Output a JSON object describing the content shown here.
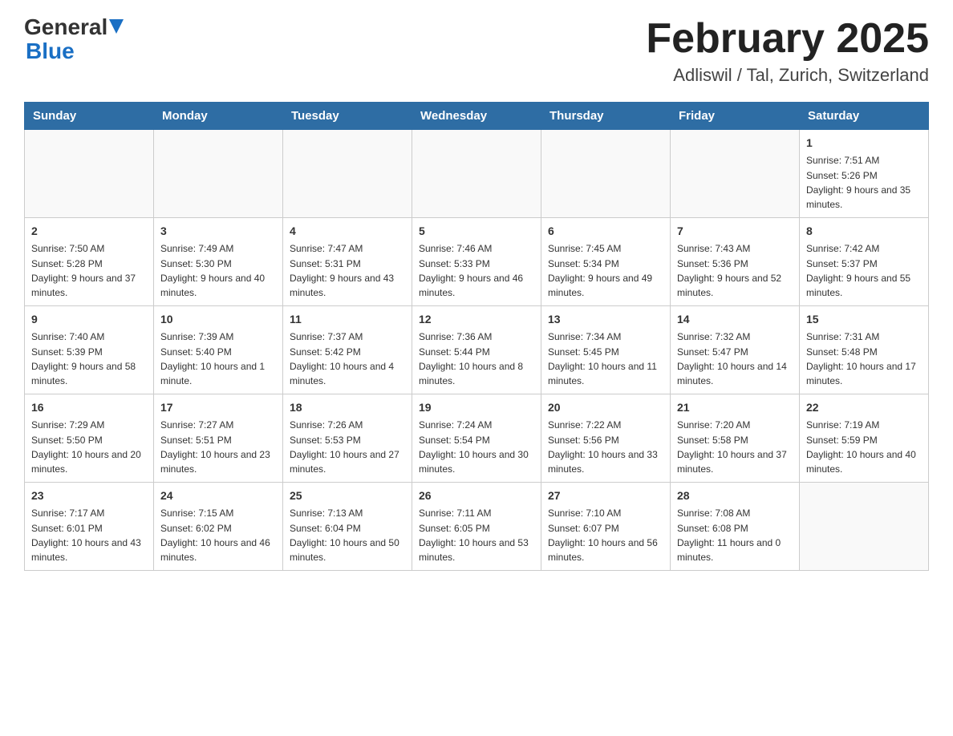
{
  "header": {
    "logo_general": "General",
    "logo_blue": "Blue",
    "month_title": "February 2025",
    "subtitle": "Adliswil / Tal, Zurich, Switzerland"
  },
  "days_of_week": [
    "Sunday",
    "Monday",
    "Tuesday",
    "Wednesday",
    "Thursday",
    "Friday",
    "Saturday"
  ],
  "weeks": [
    [
      {
        "day": "",
        "info": ""
      },
      {
        "day": "",
        "info": ""
      },
      {
        "day": "",
        "info": ""
      },
      {
        "day": "",
        "info": ""
      },
      {
        "day": "",
        "info": ""
      },
      {
        "day": "",
        "info": ""
      },
      {
        "day": "1",
        "info": "Sunrise: 7:51 AM\nSunset: 5:26 PM\nDaylight: 9 hours and 35 minutes."
      }
    ],
    [
      {
        "day": "2",
        "info": "Sunrise: 7:50 AM\nSunset: 5:28 PM\nDaylight: 9 hours and 37 minutes."
      },
      {
        "day": "3",
        "info": "Sunrise: 7:49 AM\nSunset: 5:30 PM\nDaylight: 9 hours and 40 minutes."
      },
      {
        "day": "4",
        "info": "Sunrise: 7:47 AM\nSunset: 5:31 PM\nDaylight: 9 hours and 43 minutes."
      },
      {
        "day": "5",
        "info": "Sunrise: 7:46 AM\nSunset: 5:33 PM\nDaylight: 9 hours and 46 minutes."
      },
      {
        "day": "6",
        "info": "Sunrise: 7:45 AM\nSunset: 5:34 PM\nDaylight: 9 hours and 49 minutes."
      },
      {
        "day": "7",
        "info": "Sunrise: 7:43 AM\nSunset: 5:36 PM\nDaylight: 9 hours and 52 minutes."
      },
      {
        "day": "8",
        "info": "Sunrise: 7:42 AM\nSunset: 5:37 PM\nDaylight: 9 hours and 55 minutes."
      }
    ],
    [
      {
        "day": "9",
        "info": "Sunrise: 7:40 AM\nSunset: 5:39 PM\nDaylight: 9 hours and 58 minutes."
      },
      {
        "day": "10",
        "info": "Sunrise: 7:39 AM\nSunset: 5:40 PM\nDaylight: 10 hours and 1 minute."
      },
      {
        "day": "11",
        "info": "Sunrise: 7:37 AM\nSunset: 5:42 PM\nDaylight: 10 hours and 4 minutes."
      },
      {
        "day": "12",
        "info": "Sunrise: 7:36 AM\nSunset: 5:44 PM\nDaylight: 10 hours and 8 minutes."
      },
      {
        "day": "13",
        "info": "Sunrise: 7:34 AM\nSunset: 5:45 PM\nDaylight: 10 hours and 11 minutes."
      },
      {
        "day": "14",
        "info": "Sunrise: 7:32 AM\nSunset: 5:47 PM\nDaylight: 10 hours and 14 minutes."
      },
      {
        "day": "15",
        "info": "Sunrise: 7:31 AM\nSunset: 5:48 PM\nDaylight: 10 hours and 17 minutes."
      }
    ],
    [
      {
        "day": "16",
        "info": "Sunrise: 7:29 AM\nSunset: 5:50 PM\nDaylight: 10 hours and 20 minutes."
      },
      {
        "day": "17",
        "info": "Sunrise: 7:27 AM\nSunset: 5:51 PM\nDaylight: 10 hours and 23 minutes."
      },
      {
        "day": "18",
        "info": "Sunrise: 7:26 AM\nSunset: 5:53 PM\nDaylight: 10 hours and 27 minutes."
      },
      {
        "day": "19",
        "info": "Sunrise: 7:24 AM\nSunset: 5:54 PM\nDaylight: 10 hours and 30 minutes."
      },
      {
        "day": "20",
        "info": "Sunrise: 7:22 AM\nSunset: 5:56 PM\nDaylight: 10 hours and 33 minutes."
      },
      {
        "day": "21",
        "info": "Sunrise: 7:20 AM\nSunset: 5:58 PM\nDaylight: 10 hours and 37 minutes."
      },
      {
        "day": "22",
        "info": "Sunrise: 7:19 AM\nSunset: 5:59 PM\nDaylight: 10 hours and 40 minutes."
      }
    ],
    [
      {
        "day": "23",
        "info": "Sunrise: 7:17 AM\nSunset: 6:01 PM\nDaylight: 10 hours and 43 minutes."
      },
      {
        "day": "24",
        "info": "Sunrise: 7:15 AM\nSunset: 6:02 PM\nDaylight: 10 hours and 46 minutes."
      },
      {
        "day": "25",
        "info": "Sunrise: 7:13 AM\nSunset: 6:04 PM\nDaylight: 10 hours and 50 minutes."
      },
      {
        "day": "26",
        "info": "Sunrise: 7:11 AM\nSunset: 6:05 PM\nDaylight: 10 hours and 53 minutes."
      },
      {
        "day": "27",
        "info": "Sunrise: 7:10 AM\nSunset: 6:07 PM\nDaylight: 10 hours and 56 minutes."
      },
      {
        "day": "28",
        "info": "Sunrise: 7:08 AM\nSunset: 6:08 PM\nDaylight: 11 hours and 0 minutes."
      },
      {
        "day": "",
        "info": ""
      }
    ]
  ]
}
